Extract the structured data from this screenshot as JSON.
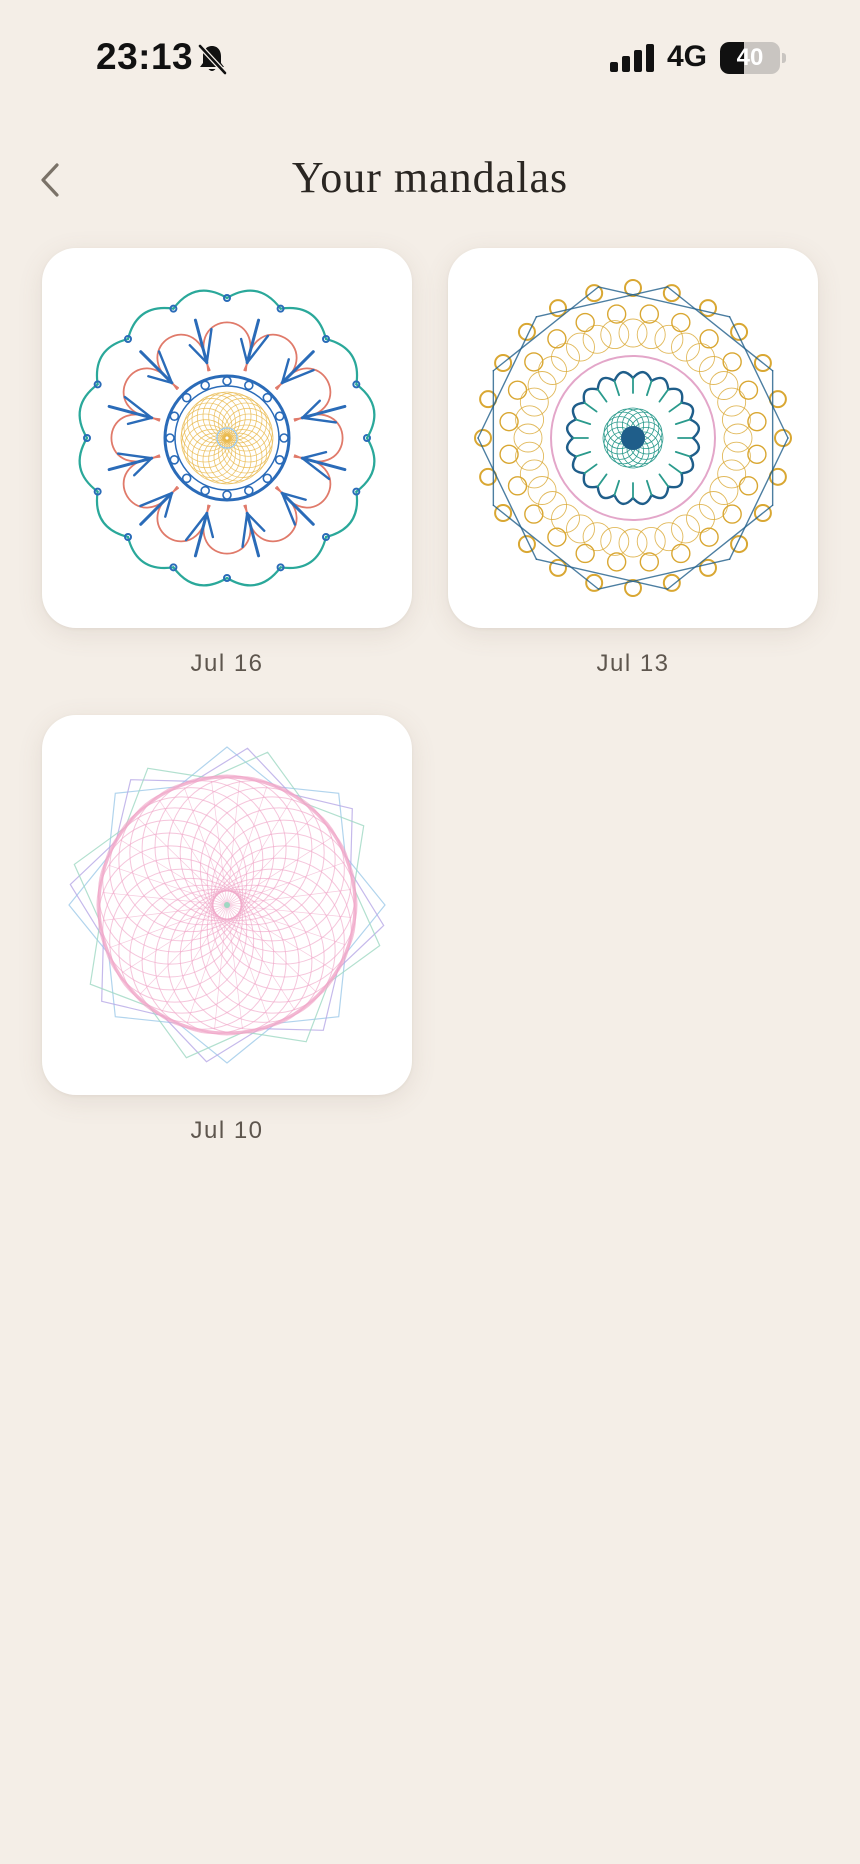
{
  "status_bar": {
    "time": "23:13",
    "network": "4G",
    "battery_level": "40",
    "battery_fraction": 0.4
  },
  "header": {
    "title": "Your mandalas",
    "back_icon": "chevron-left-icon"
  },
  "mandalas": [
    {
      "date": "Jul 16",
      "colors": [
        "#2a6bb8",
        "#2aa89a",
        "#e07a6a",
        "#e8b84a"
      ]
    },
    {
      "date": "Jul 13",
      "colors": [
        "#d9a732",
        "#1f5e8a",
        "#2a9a8c",
        "#e3a6c9"
      ]
    },
    {
      "date": "Jul 10",
      "colors": [
        "#f0a6c8",
        "#9ec9e8",
        "#b7a7e6",
        "#9fd8c3"
      ]
    }
  ]
}
